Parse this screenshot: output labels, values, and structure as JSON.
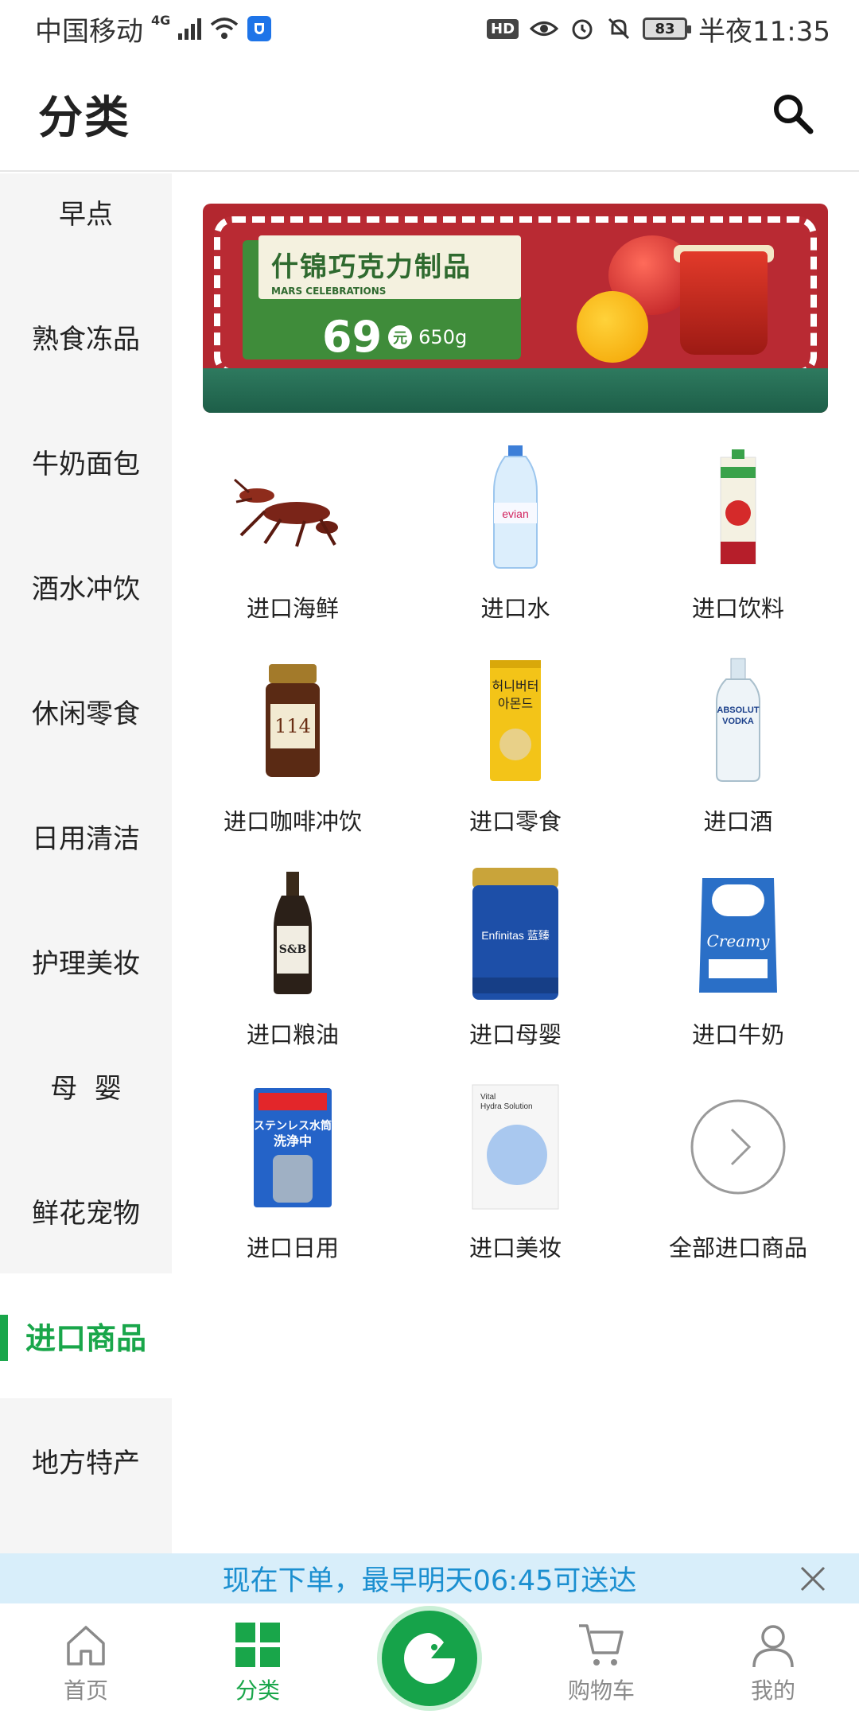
{
  "status_bar": {
    "carrier": "中国移动",
    "network": "4G",
    "battery": "83",
    "time": "半夜11:35",
    "hd_label": "HD"
  },
  "header": {
    "title": "分类"
  },
  "sidebar": {
    "items": [
      {
        "label": "早点"
      },
      {
        "label": "熟食冻品"
      },
      {
        "label": "牛奶面包"
      },
      {
        "label": "酒水冲饮"
      },
      {
        "label": "休闲零食"
      },
      {
        "label": "日用清洁"
      },
      {
        "label": "护理美妆"
      },
      {
        "label": "母  婴"
      },
      {
        "label": "鲜花宠物"
      },
      {
        "label": "进口商品"
      },
      {
        "label": "地方特产"
      }
    ],
    "active_index": 9
  },
  "banner": {
    "title": "什锦巧克力制品",
    "subtitle": "MARS CELEBRATIONS",
    "price": "69",
    "currency": "元",
    "weight": "650g"
  },
  "categories": [
    {
      "label": "进口海鲜",
      "icon": "lobster-icon"
    },
    {
      "label": "进口水",
      "icon": "water-bottle-icon"
    },
    {
      "label": "进口饮料",
      "icon": "juice-box-icon"
    },
    {
      "label": "进口咖啡冲饮",
      "icon": "coffee-jar-icon"
    },
    {
      "label": "进口零食",
      "icon": "snack-bag-icon"
    },
    {
      "label": "进口酒",
      "icon": "vodka-bottle-icon"
    },
    {
      "label": "进口粮油",
      "icon": "sauce-bottle-icon"
    },
    {
      "label": "进口母婴",
      "icon": "formula-can-icon"
    },
    {
      "label": "进口牛奶",
      "icon": "milk-powder-icon"
    },
    {
      "label": "进口日用",
      "icon": "cleaner-box-icon"
    },
    {
      "label": "进口美妆",
      "icon": "face-mask-icon"
    },
    {
      "label": "全部进口商品",
      "icon": "chevron-right-circle-icon"
    }
  ],
  "notice": {
    "text": "现在下单，最早明天06:45可送达"
  },
  "bottom_nav": {
    "home": "首页",
    "category": "分类",
    "cart": "购物车",
    "me": "我的"
  },
  "colors": {
    "accent": "#19a64a",
    "notice_bg": "#d8eefa",
    "notice_text": "#1b8fd0"
  }
}
